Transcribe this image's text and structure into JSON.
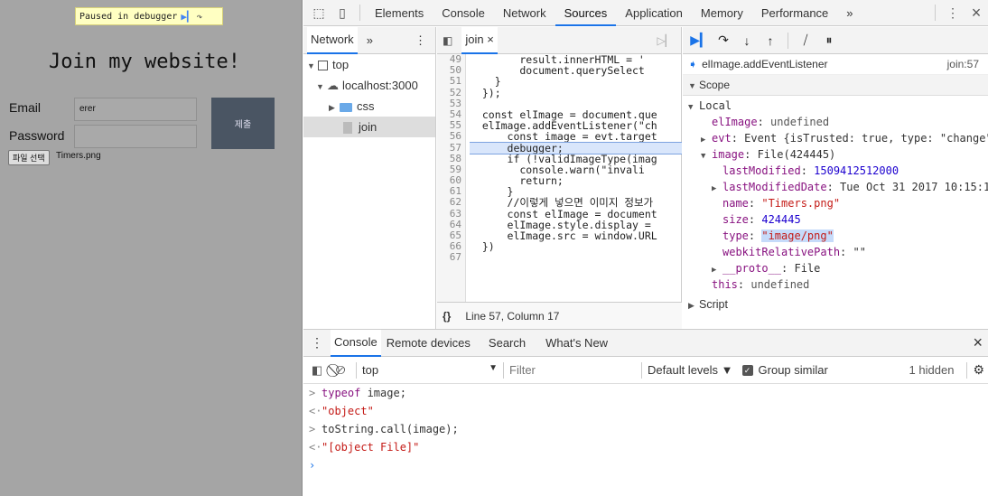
{
  "page": {
    "debugger_banner": "Paused in debugger",
    "title": "Join my website!",
    "email_label": "Email",
    "email_value": "erer",
    "password_label": "Password",
    "submit_label": "제출",
    "file_button": "파일 선택",
    "file_name": "Timers.png"
  },
  "devtools": {
    "tabs": [
      "Elements",
      "Console",
      "Network",
      "Sources",
      "Application",
      "Memory",
      "Performance"
    ],
    "active_tab": "Sources",
    "more_tabs": "»",
    "menu": "⋮",
    "close": "×"
  },
  "navigator": {
    "tab": "Network",
    "more": "»",
    "menu": "⋮",
    "tree": [
      {
        "label": "top",
        "icon": "frame-icon",
        "indent": 0,
        "expanded": true
      },
      {
        "label": "localhost:3000",
        "icon": "cloud-icon",
        "indent": 1,
        "expanded": true
      },
      {
        "label": "css",
        "icon": "folder-icon",
        "indent": 2,
        "expanded": false
      },
      {
        "label": "join",
        "icon": "file-icon",
        "indent": 3,
        "selected": true
      }
    ]
  },
  "editor": {
    "tab": "join",
    "tab_close": "×",
    "status": "Line 57, Column 17",
    "format_icon": "{}",
    "line_numbers": [
      "49",
      "50",
      "51",
      "52",
      "53",
      "54",
      "55",
      "56",
      "57",
      "58",
      "59",
      "60",
      "61",
      "62",
      "63",
      "64",
      "65",
      "66",
      "67"
    ],
    "highlight_line": "57",
    "lines": [
      "        result.innerHTML = '",
      "        document.querySelect",
      "    }",
      "  });",
      "",
      "  const elImage = document.que",
      "  elImage.addEventListener(\"ch",
      "      const image = evt.target",
      "      debugger;",
      "      if (!validImageType(imag",
      "        console.warn(\"invali",
      "        return;",
      "      }",
      "      //이렇게 넣으면 이미지 정보가 ",
      "      const elImage = document",
      "      elImage.style.display = ",
      "      elImage.src = window.URL",
      "  })",
      ""
    ]
  },
  "debugger": {
    "call_frame": "elImage.addEventListener",
    "call_location": "join:57",
    "scope_header": "Scope",
    "local_header": "Local",
    "script_header": "Script",
    "local": [
      {
        "name": "elImage",
        "sep": ": ",
        "value": "undefined",
        "kind": "gray",
        "indent": 1
      },
      {
        "name": "evt",
        "sep": ": ",
        "value": "Event {isTrusted: true, type: \"change\"",
        "kind": "plain",
        "indent": 1,
        "arrow": "▶"
      },
      {
        "name": "image",
        "sep": ": ",
        "value": "File(424445)",
        "kind": "plain",
        "indent": 1,
        "arrow": "▼"
      },
      {
        "name": "lastModified",
        "sep": ": ",
        "value": "1509412512000",
        "kind": "num",
        "indent": 2
      },
      {
        "name": "lastModifiedDate",
        "sep": ": ",
        "value": "Tue Oct 31 2017 10:15:1",
        "kind": "plain",
        "indent": 2,
        "arrow": "▶"
      },
      {
        "name": "name",
        "sep": ": ",
        "value": "\"Timers.png\"",
        "kind": "str",
        "indent": 2
      },
      {
        "name": "size",
        "sep": ": ",
        "value": "424445",
        "kind": "num",
        "indent": 2
      },
      {
        "name": "type",
        "sep": ": ",
        "value": "\"image/png\"",
        "kind": "strhl",
        "indent": 2
      },
      {
        "name": "webkitRelativePath",
        "sep": ": ",
        "value": "\"\"",
        "kind": "plain",
        "indent": 2
      },
      {
        "name": "__proto__",
        "sep": ": ",
        "value": "File",
        "kind": "plain",
        "indent": 2,
        "arrow": "▶"
      },
      {
        "name": "this",
        "sep": ": ",
        "value": "undefined",
        "kind": "gray",
        "indent": 1
      }
    ]
  },
  "drawer": {
    "tabs": [
      "Console",
      "Remote devices",
      "Search",
      "What's New"
    ],
    "context": "top",
    "filter_placeholder": "Filter",
    "levels": "Default levels ▼",
    "group_similar": "Group similar",
    "hidden": "1 hidden",
    "lines": [
      {
        "prompt": ">",
        "kw": "typeof",
        "text": " image;",
        "kind": "input"
      },
      {
        "prompt": "<·",
        "kw": "",
        "text": "\"object\"",
        "kind": "result"
      },
      {
        "prompt": ">",
        "kw": "",
        "text": "toString.call(image);",
        "kind": "input"
      },
      {
        "prompt": "<·",
        "kw": "",
        "text": "\"[object File]\"",
        "kind": "result"
      }
    ]
  }
}
